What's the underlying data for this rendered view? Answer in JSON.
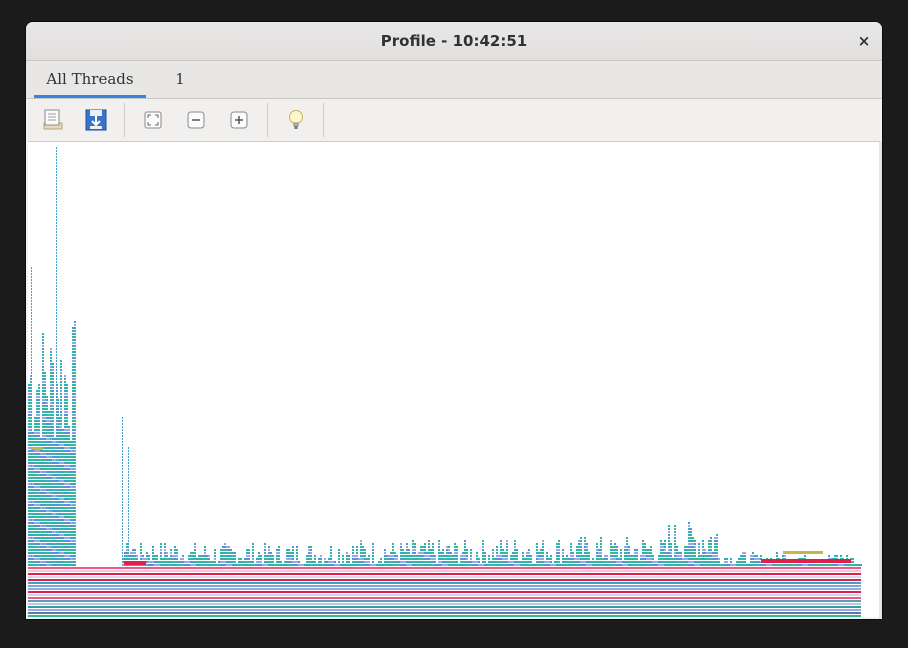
{
  "window": {
    "title": "Profile  -  10:42:51",
    "close_label": "×"
  },
  "tabs": [
    {
      "label": "All Threads",
      "active": true
    },
    {
      "label": "1",
      "active": false
    }
  ],
  "toolbar": {
    "buttons": [
      {
        "name": "open-button",
        "icon": "open-file-icon"
      },
      {
        "name": "save-button",
        "icon": "save-download-icon"
      },
      {
        "name": "zoom-fit-button",
        "icon": "zoom-fit-icon"
      },
      {
        "name": "zoom-out-button",
        "icon": "zoom-out-icon"
      },
      {
        "name": "zoom-in-button",
        "icon": "zoom-in-icon"
      },
      {
        "name": "hint-button",
        "icon": "lightbulb-icon"
      }
    ]
  },
  "colors": {
    "accent": "#3584e4",
    "stack_teal": "#3aa6c6",
    "stack_green": "#2fbf8f",
    "stack_blue": "#5b8fd9",
    "stack_lavender": "#9aa6e8",
    "stack_red": "#e0204a",
    "stack_pink": "#e85a8a",
    "stack_olive": "#c8b24a"
  }
}
